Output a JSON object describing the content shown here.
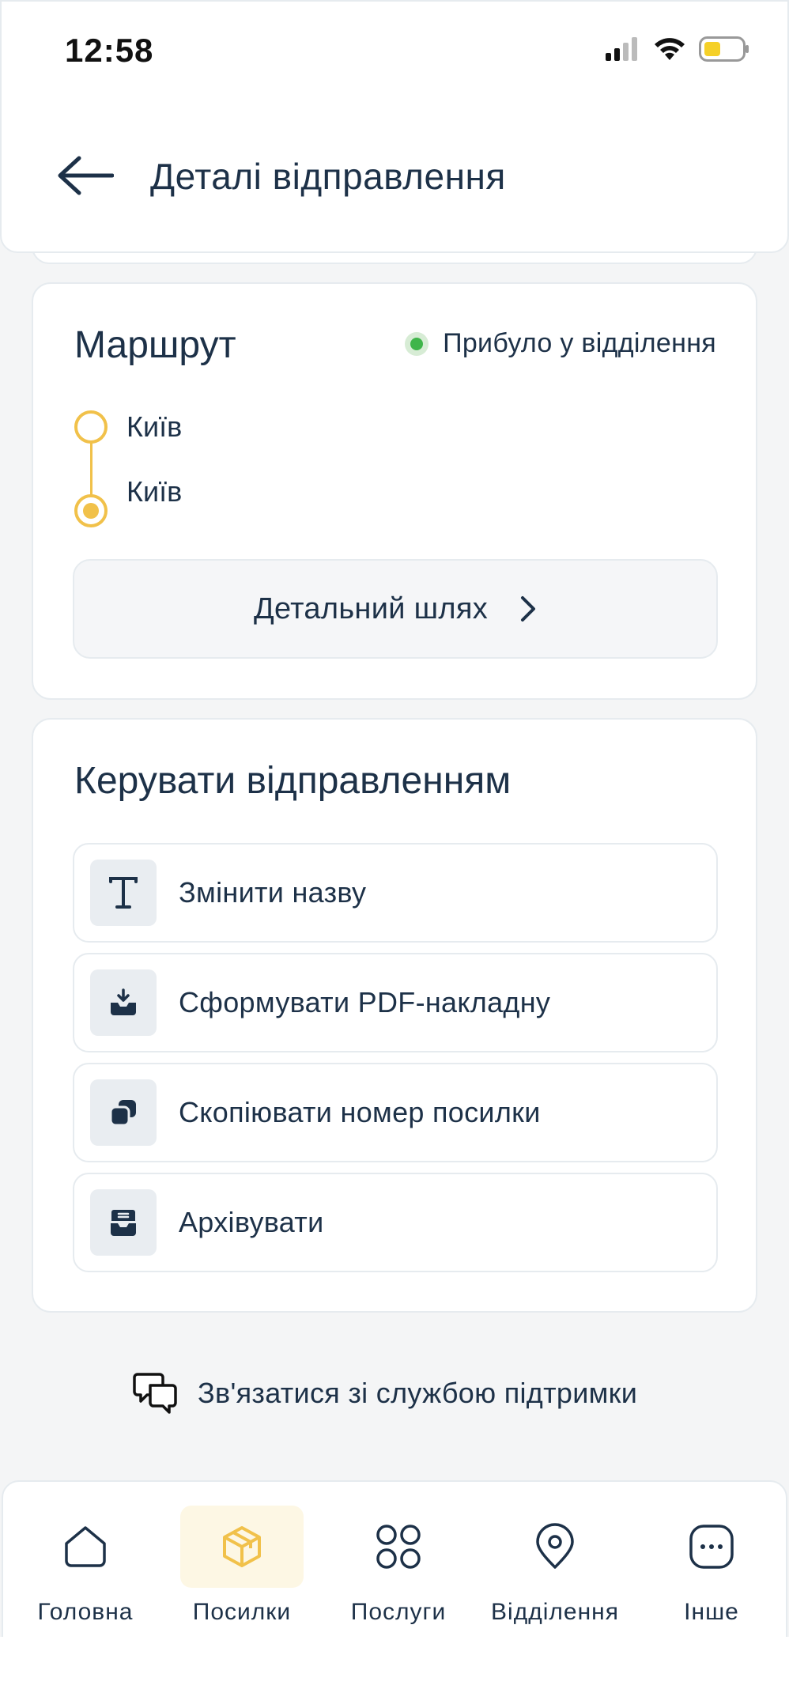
{
  "status_bar": {
    "time": "12:58"
  },
  "header": {
    "title": "Деталі відправлення"
  },
  "route": {
    "title": "Маршрут",
    "status": "Прибуло у відділення",
    "from_city": "Київ",
    "to_city": "Київ",
    "detail_button": "Детальний шлях"
  },
  "manage": {
    "title": "Керувати відправленням",
    "actions": [
      {
        "label": "Змінити назву",
        "icon": "text-icon"
      },
      {
        "label": "Сформувати PDF-накладну",
        "icon": "download-icon"
      },
      {
        "label": "Скопіювати номер посилки",
        "icon": "copy-icon"
      },
      {
        "label": "Архівувати",
        "icon": "archive-icon"
      }
    ]
  },
  "support": {
    "label": "Зв'язатися зі службою підтримки"
  },
  "nav": {
    "items": [
      {
        "label": "Головна",
        "icon": "home-icon"
      },
      {
        "label": "Посилки",
        "icon": "package-icon",
        "active": true
      },
      {
        "label": "Послуги",
        "icon": "grid-icon"
      },
      {
        "label": "Відділення",
        "icon": "location-pin-icon"
      },
      {
        "label": "Інше",
        "icon": "more-icon"
      }
    ]
  },
  "colors": {
    "accent": "#f1c14a",
    "text": "#1d3148",
    "status_green": "#3fb54a"
  }
}
